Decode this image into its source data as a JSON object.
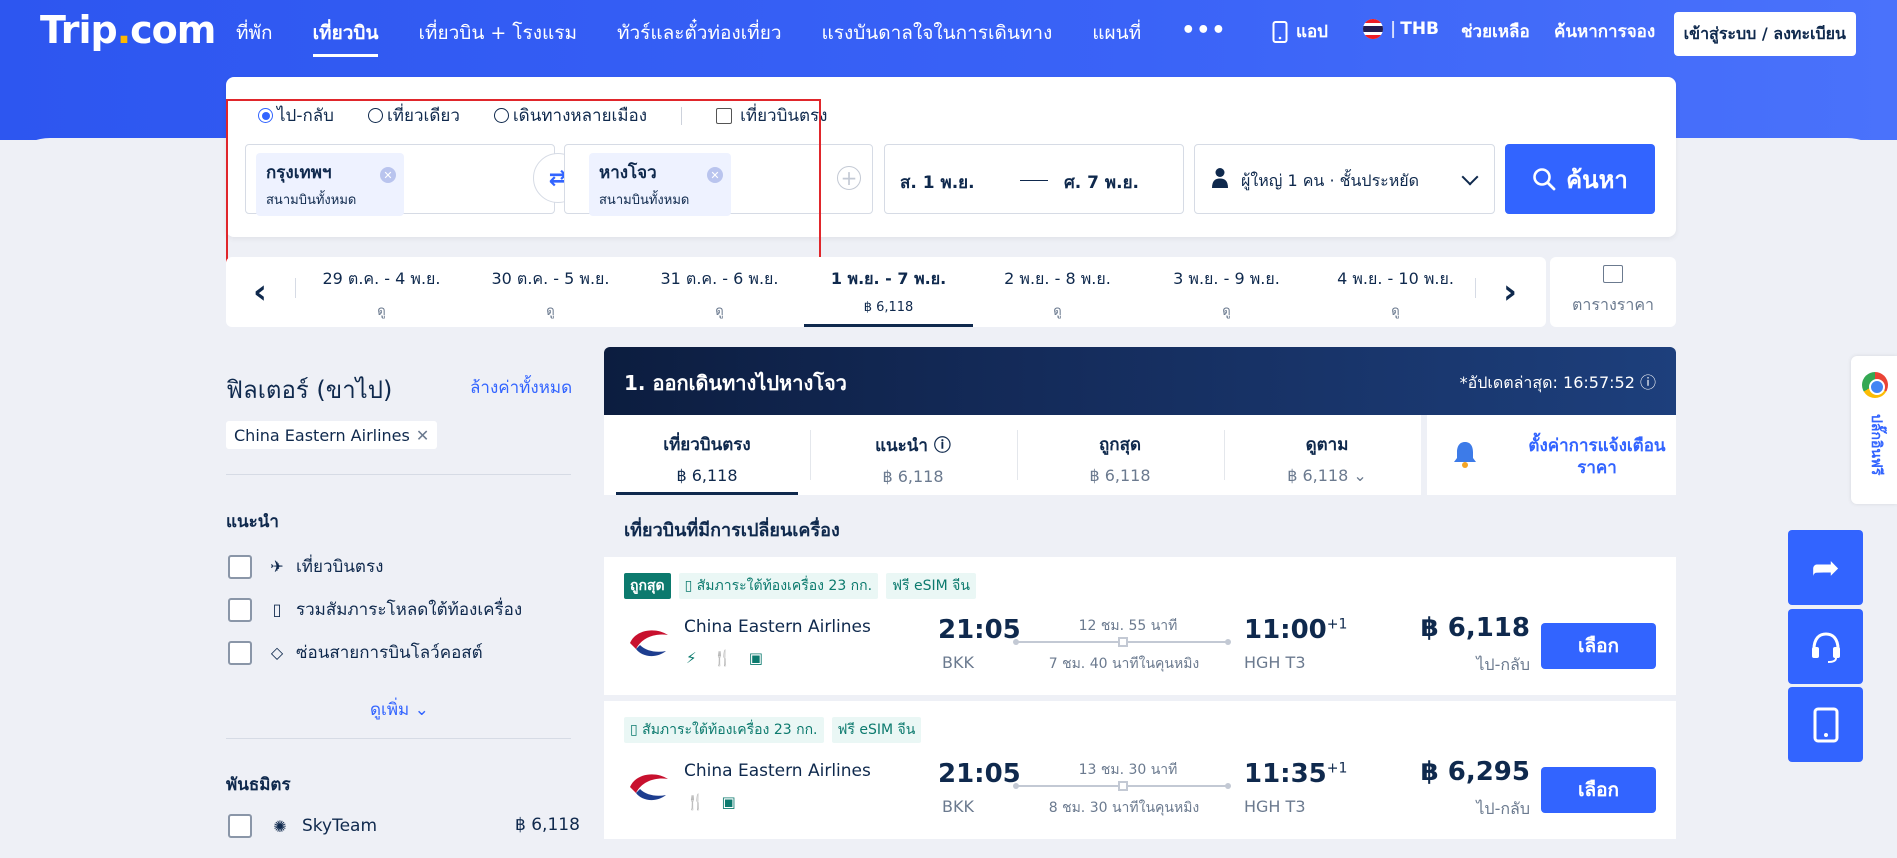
{
  "header": {
    "logo_main": "Trip",
    "logo_dot": ".",
    "logo_tld": "com",
    "nav": [
      {
        "label": "ที่พัก",
        "active": false
      },
      {
        "label": "เที่ยวบิน",
        "active": true
      },
      {
        "label": "เที่ยวบิน + โรงแรม",
        "active": false
      },
      {
        "label": "ทัวร์และตั๋วท่องเที่ยว",
        "active": false
      },
      {
        "label": "แรงบันดาลใจในการเดินทาง",
        "active": false
      },
      {
        "label": "แผนที่",
        "active": false
      }
    ],
    "more": "•••",
    "app": "แอป",
    "currency": "THB",
    "help": "ช่วยเหลือ",
    "bookings": "ค้นหาการจอง",
    "login": "เข้าสู่ระบบ / ลงทะเบียน"
  },
  "search": {
    "trip_types": [
      "ไป-กลับ",
      "เที่ยวเดียว",
      "เดินทางหลายเมือง"
    ],
    "selected_trip_type": "ไป-กลับ",
    "direct_only": "เที่ยวบินตรง",
    "origin": {
      "city": "กรุงเทพฯ",
      "airport": "สนามบินทั้งหมด"
    },
    "destination": {
      "city": "หางโจว",
      "airport": "สนามบินทั้งหมด"
    },
    "depart_date": "ส. 1 พ.ย.",
    "return_date": "ศ. 7 พ.ย.",
    "passengers": "ผู้ใหญ่ 1 คน · ชั้นประหยัด",
    "search_button": "ค้นหา"
  },
  "date_bar": {
    "cells": [
      {
        "range": "29 ต.ค. - 4 พ.ย.",
        "price": "ดู",
        "active": false
      },
      {
        "range": "30 ต.ค. - 5 พ.ย.",
        "price": "ดู",
        "active": false
      },
      {
        "range": "31 ต.ค. - 6 พ.ย.",
        "price": "ดู",
        "active": false
      },
      {
        "range": "1 พ.ย. - 7 พ.ย.",
        "price": "฿ 6,118",
        "active": true
      },
      {
        "range": "2 พ.ย. - 8 พ.ย.",
        "price": "ดู",
        "active": false
      },
      {
        "range": "3 พ.ย. - 9 พ.ย.",
        "price": "ดู",
        "active": false
      },
      {
        "range": "4 พ.ย. - 10 พ.ย.",
        "price": "ดู",
        "active": false
      }
    ],
    "calendar_label": "ตารางราคา"
  },
  "filters": {
    "title": "ฟิลเตอร์ (ขาไป)",
    "clear_all": "ล้างค่าทั้งหมด",
    "active_tag": "China Eastern Airlines",
    "recommended_heading": "แนะนำ",
    "recommended": [
      {
        "label": "เที่ยวบินตรง",
        "icon": "plane-takeoff-icon"
      },
      {
        "label": "รวมสัมภาระโหลดใต้ท้องเครื่อง",
        "icon": "luggage-icon"
      },
      {
        "label": "ซ่อนสายการบินโลว์คอสต์",
        "icon": "tag-icon"
      }
    ],
    "see_more": "ดูเพิ่ม",
    "alliance_heading": "พันธมิตร",
    "alliances": [
      {
        "label": "SkyTeam",
        "price": "฿ 6,118"
      }
    ]
  },
  "results": {
    "header_title": "1. ออกเดินทางไปหางโจว",
    "updated": "*อัปเดตล่าสุด: 16:57:52",
    "sort_tabs": [
      {
        "name": "เที่ยวบินตรง",
        "price": "฿ 6,118",
        "active": true
      },
      {
        "name": "แนะนำ",
        "price": "฿ 6,118",
        "active": false
      },
      {
        "name": "ถูกสุด",
        "price": "฿ 6,118",
        "active": false
      },
      {
        "name": "ดูตาม",
        "price": "฿ 6,118",
        "active": false
      }
    ],
    "price_alert": "ตั้งค่าการแจ้งเตือนราคา",
    "section_title": "เที่ยวบินที่มีการเปลี่ยนเครื่อง",
    "flights": [
      {
        "badges": [
          "ถูกสุด",
          "สัมภาระใต้ท้องเครื่อง 23 กก.",
          "ฟรี eSIM จีน"
        ],
        "airline": "China Eastern Airlines",
        "amenities": "⚡ 🍴 ▣",
        "dep_time": "21:05",
        "dep_code": "BKK",
        "duration": "12 ชม. 55 นาที",
        "layover": "7 ชม. 40 นาทีในคุนหมิง",
        "arr_time": "11:00",
        "arr_plus": "+1",
        "arr_code": "HGH T3",
        "price": "฿ 6,118",
        "price_note": "ไป-กลับ",
        "select": "เลือก"
      },
      {
        "badges": [
          "สัมภาระใต้ท้องเครื่อง 23 กก.",
          "ฟรี eSIM จีน"
        ],
        "airline": "China Eastern Airlines",
        "amenities": "🍴 ▣",
        "dep_time": "21:05",
        "dep_code": "BKK",
        "duration": "13 ชม. 30 นาที",
        "layover": "8 ชม. 30 นาทีในคุนหมิง",
        "arr_time": "11:35",
        "arr_plus": "+1",
        "arr_code": "HGH T3",
        "price": "฿ 6,295",
        "price_note": "ไป-กลับ",
        "select": "เลือก"
      }
    ]
  },
  "side": {
    "chrome_label": "ปลั๊กอินฟรี"
  }
}
